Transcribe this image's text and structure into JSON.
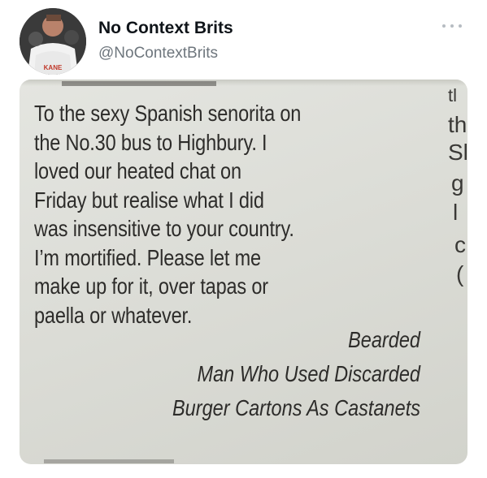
{
  "tweet": {
    "display_name": "No Context Brits",
    "handle": "@NoContextBrits",
    "avatar_label": "KANE",
    "more_icon": "ellipsis-icon"
  },
  "media": {
    "clipping_lines": [
      "To the sexy Spanish senorita on",
      "the No.30 bus to Highbury. I",
      "loved our heated chat on",
      "Friday but realise what I did",
      "was insensitive to your country.",
      "I’m mortified. Please let me",
      "make up for it, over tapas or",
      "paella or whatever."
    ],
    "signoff_lines": [
      "Bearded",
      "Man Who Used Discarded",
      "Burger Cartons As Castanets"
    ],
    "right_column_fragments": [
      "tl",
      "th",
      "Sl",
      "g",
      "l",
      "c",
      "("
    ]
  },
  "colors": {
    "name": "#0f1419",
    "handle": "#6e767d",
    "paper": "#dcddd7",
    "ink": "#2d2c2a"
  }
}
